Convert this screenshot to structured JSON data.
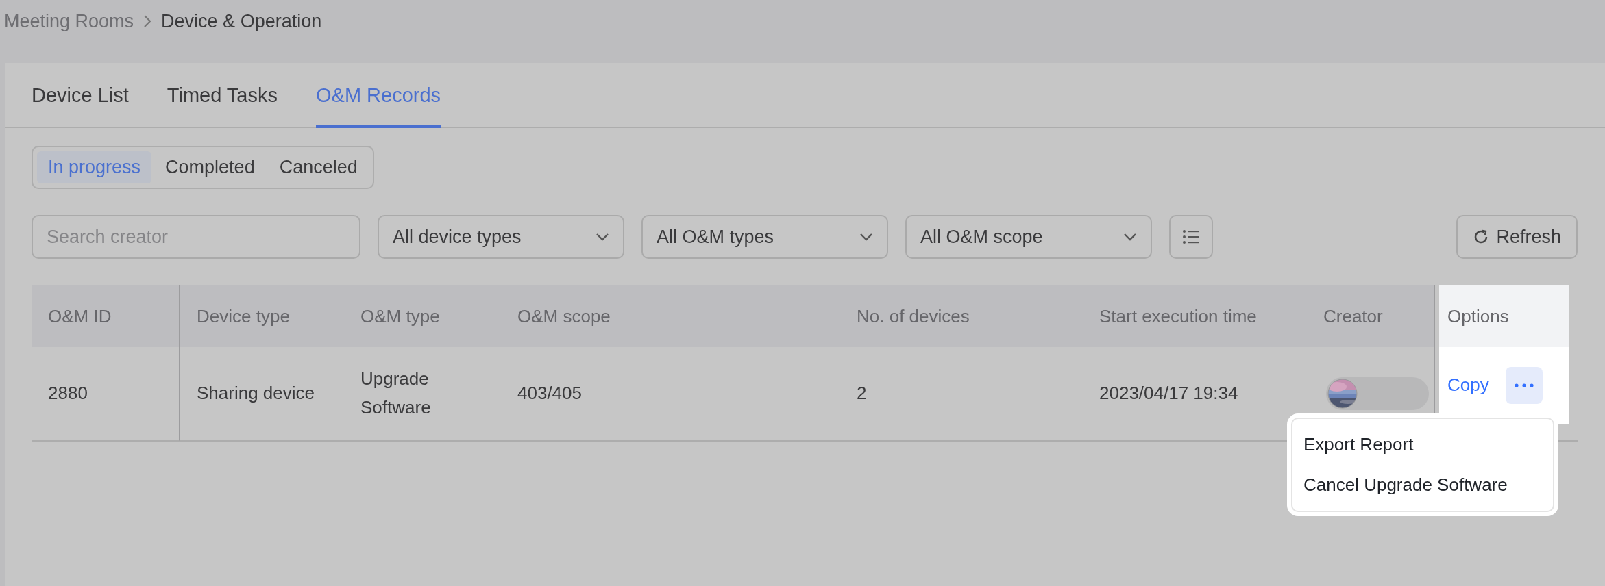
{
  "breadcrumb": [
    {
      "label": "Meeting Rooms"
    },
    {
      "label": "Device & Operation"
    }
  ],
  "tabs": [
    {
      "label": "Device List",
      "selected": false
    },
    {
      "label": "Timed Tasks",
      "selected": false
    },
    {
      "label": "O&M Records",
      "selected": true
    }
  ],
  "status_filter": [
    {
      "label": "In progress",
      "selected": true
    },
    {
      "label": "Completed",
      "selected": false
    },
    {
      "label": "Canceled",
      "selected": false
    }
  ],
  "search": {
    "placeholder": "Search creator"
  },
  "dropdowns": [
    {
      "value": "All device types"
    },
    {
      "value": "All O&M types"
    },
    {
      "value": "All O&M scope"
    }
  ],
  "refresh_button": {
    "label": "Refresh"
  },
  "table": {
    "columns": [
      "O&M ID",
      "Device type",
      "O&M type",
      "O&M scope",
      "No. of devices",
      "Start execution time",
      "Creator",
      "Options"
    ],
    "rows": [
      {
        "cells": [
          "2880",
          "Sharing device",
          "Upgrade Software",
          "403/405",
          "2",
          "2023/04/17 19:34"
        ],
        "copy_link": "Copy"
      }
    ]
  },
  "more_menu": {
    "items": [
      {
        "label": "Export Report"
      },
      {
        "label": "Cancel Upgrade Software"
      }
    ]
  }
}
